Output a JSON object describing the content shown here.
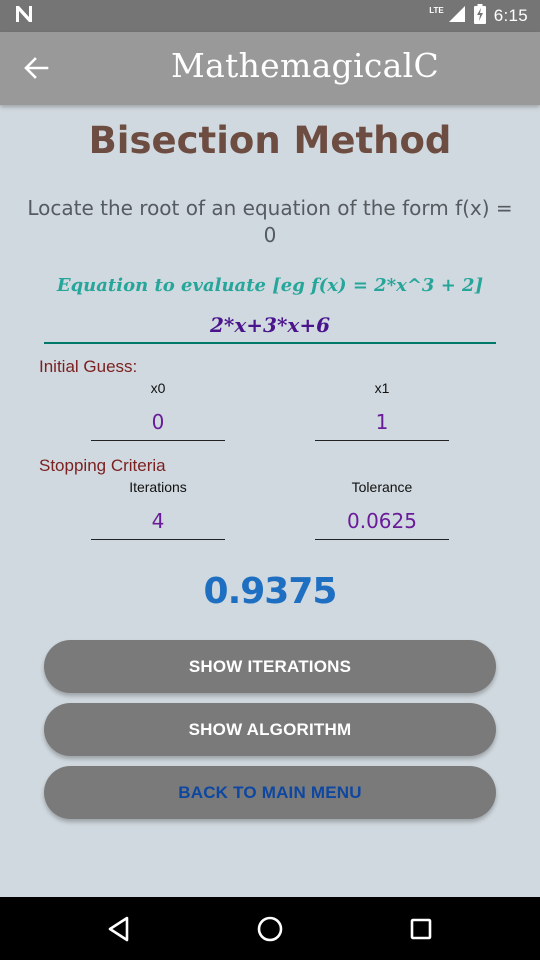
{
  "status_bar": {
    "time": "6:15",
    "network": "LTE",
    "icons": [
      "notification-n-icon",
      "signal-icon",
      "battery-charging-icon"
    ]
  },
  "app_bar": {
    "title": "MathemagicalC",
    "back_icon": "arrow-back-icon"
  },
  "page": {
    "title": "Bisection Method",
    "description": "Locate the root of an equation of the form f(x) = 0"
  },
  "equation": {
    "label": "Equation to evaluate [eg f(x) = 2*x^3 + 2]",
    "value": "2*x+3*x+6"
  },
  "initial_guess": {
    "label": "Initial Guess:",
    "x0_label": "x0",
    "x0_value": "0",
    "x1_label": "x1",
    "x1_value": "1"
  },
  "stopping": {
    "label": "Stopping Criteria",
    "iterations_label": "Iterations",
    "iterations_value": "4",
    "tolerance_label": "Tolerance",
    "tolerance_value": "0.0625"
  },
  "result": "0.9375",
  "buttons": {
    "show_iterations": "SHOW ITERATIONS",
    "show_algorithm": "SHOW ALGORITHM",
    "back_to_main": "BACK TO MAIN MENU"
  },
  "nav_bar": {
    "icons": [
      "back-triangle-icon",
      "home-circle-icon",
      "recents-square-icon"
    ]
  },
  "colors": {
    "background": "#d0d9df",
    "app_bar": "#999999",
    "title": "#6d4c41",
    "equation_label": "#26a69a",
    "input_text": "#6a1b9a",
    "section_label": "#7b1f1f",
    "result": "#1e6fc2",
    "button": "#7a7a7a",
    "back_button_text": "#0d47a1"
  }
}
